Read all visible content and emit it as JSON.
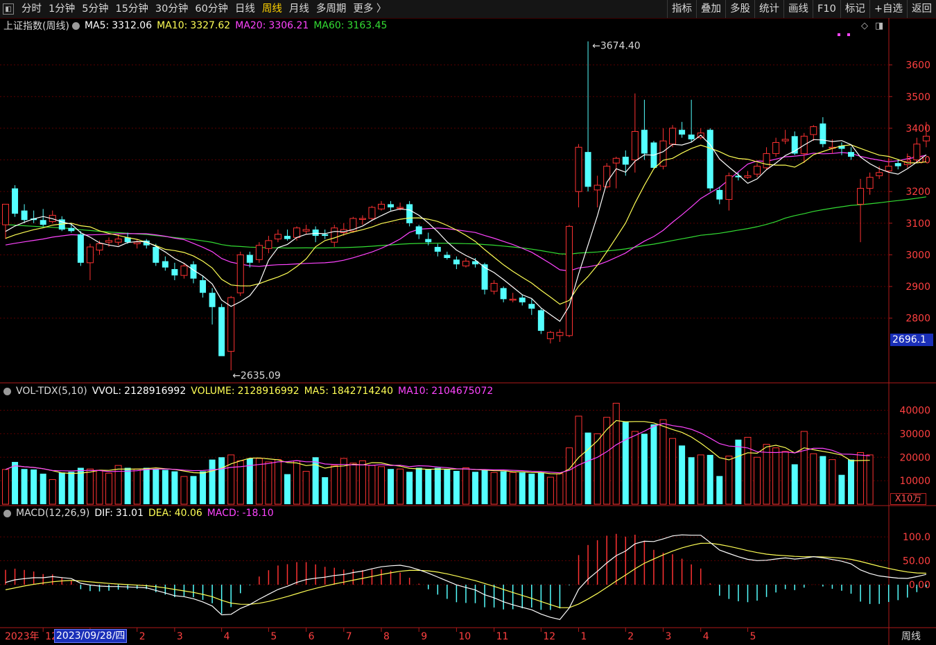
{
  "toolbar": {
    "tabs": [
      "分时",
      "1分钟",
      "5分钟",
      "15分钟",
      "30分钟",
      "60分钟",
      "日线",
      "周线",
      "月线",
      "多周期",
      "更多 〉"
    ],
    "active": "周线",
    "right": [
      "指标",
      "叠加",
      "多股",
      "统计",
      "画线",
      "F10",
      "标记",
      "+自选",
      "返回"
    ]
  },
  "legend": {
    "title": "上证指数(周线)",
    "ma5_label": "MA5:",
    "ma5": "3312.06",
    "ma10_label": "MA10:",
    "ma10": "3327.62",
    "ma20_label": "MA20:",
    "ma20": "3306.21",
    "ma60_label": "MA60:",
    "ma60": "3163.45"
  },
  "vol_legend": {
    "name": "VOL-TDX(5,10)",
    "vvol_label": "VVOL:",
    "vvol": "2128916992",
    "volume_label": "VOLUME:",
    "volume": "2128916992",
    "ma5_label": "MA5:",
    "ma5": "1842714240",
    "ma10_label": "MA10:",
    "ma10": "2104675072"
  },
  "macd_legend": {
    "name": "MACD(12,26,9)",
    "dif_label": "DIF:",
    "dif": "31.01",
    "dea_label": "DEA:",
    "dea": "40.06",
    "macd_label": "MACD:",
    "macd": "-18.10"
  },
  "annotations": {
    "high": "3674.40",
    "low": "2635.09"
  },
  "cursor": {
    "date": "2023/09/28/四",
    "price": "2696.1"
  },
  "bottom": {
    "year": "2023年",
    "period": "周线",
    "unit": "X10万"
  },
  "colors": {
    "up": "#ff3232",
    "down": "#54ffff",
    "ma5": "#ffffff",
    "ma10": "#ffff55",
    "ma20": "#ff44ff",
    "ma60": "#33dd33",
    "grid": "#5a0000",
    "axis": "#b01a1a"
  },
  "chart_data": {
    "type": "candlestick",
    "price_axis": {
      "ticks": [
        2800,
        2900,
        3000,
        3100,
        3200,
        3300,
        3400,
        3500,
        3600
      ],
      "range": [
        2600,
        3700
      ]
    },
    "volume_axis": {
      "ticks": [
        10000,
        20000,
        30000,
        40000
      ],
      "range": [
        0,
        44000
      ]
    },
    "macd_axis": {
      "ticks": [
        "0.00",
        "50.00",
        "100.0"
      ],
      "range": [
        -90,
        135
      ]
    },
    "month_labels": [
      {
        "i": 4,
        "t": "12"
      },
      {
        "i": 9,
        "t": "1"
      },
      {
        "i": 14,
        "t": "2"
      },
      {
        "i": 18,
        "t": "3"
      },
      {
        "i": 23,
        "t": "4"
      },
      {
        "i": 28,
        "t": "5"
      },
      {
        "i": 32,
        "t": "6"
      },
      {
        "i": 36,
        "t": "7"
      },
      {
        "i": 40,
        "t": "8"
      },
      {
        "i": 44,
        "t": "9"
      },
      {
        "i": 48,
        "t": "10"
      },
      {
        "i": 52,
        "t": "11"
      },
      {
        "i": 57,
        "t": "12"
      },
      {
        "i": 61,
        "t": "1"
      },
      {
        "i": 66,
        "t": "2"
      },
      {
        "i": 70,
        "t": "3"
      },
      {
        "i": 74,
        "t": "4"
      },
      {
        "i": 79,
        "t": "5"
      }
    ],
    "candles": [
      [
        3095,
        3160,
        3160,
        3050
      ],
      [
        3210,
        3130,
        3220,
        3120
      ],
      [
        3140,
        3110,
        3160,
        3100
      ],
      [
        3115,
        3110,
        3140,
        3100
      ],
      [
        3110,
        3095,
        3145,
        3090
      ],
      [
        3105,
        3125,
        3140,
        3100
      ],
      [
        3112,
        3080,
        3122,
        3075
      ],
      [
        3085,
        3075,
        3100,
        3070
      ],
      [
        3065,
        2975,
        3075,
        2965
      ],
      [
        2975,
        3025,
        3035,
        2920
      ],
      [
        3015,
        3035,
        3045,
        3000
      ],
      [
        3040,
        3045,
        3055,
        3025
      ],
      [
        3040,
        3050,
        3065,
        3030
      ],
      [
        3055,
        3040,
        3070,
        3035
      ],
      [
        3035,
        3040,
        3050,
        3020
      ],
      [
        3045,
        3030,
        3050,
        3020
      ],
      [
        3025,
        2975,
        3035,
        2965
      ],
      [
        2980,
        2960,
        2995,
        2950
      ],
      [
        2955,
        2935,
        2975,
        2920
      ],
      [
        2935,
        2965,
        2975,
        2925
      ],
      [
        2970,
        2925,
        2980,
        2910
      ],
      [
        2920,
        2880,
        2935,
        2865
      ],
      [
        2880,
        2835,
        2895,
        2780
      ],
      [
        2835,
        2680,
        2845,
        2680
      ],
      [
        2695,
        2865,
        2870,
        2635
      ],
      [
        2880,
        3000,
        3010,
        2870
      ],
      [
        3000,
        2975,
        3010,
        2960
      ],
      [
        2985,
        3030,
        3040,
        2975
      ],
      [
        3020,
        3045,
        3060,
        3005
      ],
      [
        3050,
        3065,
        3080,
        3040
      ],
      [
        3060,
        3050,
        3080,
        3045
      ],
      [
        3055,
        3085,
        3090,
        3045
      ],
      [
        3075,
        3080,
        3095,
        3065
      ],
      [
        3080,
        3060,
        3090,
        3040
      ],
      [
        3065,
        3060,
        3080,
        3050
      ],
      [
        3040,
        3085,
        3095,
        3025
      ],
      [
        3070,
        3080,
        3100,
        3060
      ],
      [
        3075,
        3115,
        3120,
        3070
      ],
      [
        3115,
        3115,
        3125,
        3095
      ],
      [
        3115,
        3150,
        3155,
        3110
      ],
      [
        3145,
        3160,
        3170,
        3140
      ],
      [
        3160,
        3150,
        3170,
        3140
      ],
      [
        3150,
        3150,
        3165,
        3140
      ],
      [
        3160,
        3100,
        3170,
        3090
      ],
      [
        3090,
        3065,
        3095,
        3050
      ],
      [
        3050,
        3040,
        3070,
        3030
      ],
      [
        3025,
        3010,
        3035,
        2995
      ],
      [
        3000,
        2990,
        3010,
        2985
      ],
      [
        2985,
        2970,
        2995,
        2955
      ],
      [
        2965,
        2980,
        2990,
        2960
      ],
      [
        2980,
        2970,
        2990,
        2960
      ],
      [
        2970,
        2890,
        2975,
        2875
      ],
      [
        2885,
        2910,
        2920,
        2875
      ],
      [
        2895,
        2860,
        2900,
        2850
      ],
      [
        2860,
        2860,
        2880,
        2850
      ],
      [
        2865,
        2850,
        2875,
        2840
      ],
      [
        2845,
        2830,
        2860,
        2810
      ],
      [
        2825,
        2760,
        2830,
        2750
      ],
      [
        2735,
        2755,
        2760,
        2720
      ],
      [
        2745,
        2755,
        2765,
        2725
      ],
      [
        2745,
        3090,
        3095,
        2740
      ],
      [
        3200,
        3340,
        3350,
        3150
      ],
      [
        3325,
        3215,
        3674.4,
        3200
      ],
      [
        3205,
        3220,
        3250,
        3150
      ],
      [
        3215,
        3280,
        3290,
        3210
      ],
      [
        3290,
        3305,
        3310,
        3210
      ],
      [
        3310,
        3285,
        3330,
        3250
      ],
      [
        3300,
        3390,
        3510,
        3260
      ],
      [
        3395,
        3320,
        3490,
        3300
      ],
      [
        3355,
        3275,
        3360,
        3270
      ],
      [
        3280,
        3360,
        3400,
        3270
      ],
      [
        3350,
        3400,
        3410,
        3340
      ],
      [
        3395,
        3380,
        3420,
        3370
      ],
      [
        3380,
        3365,
        3490,
        3355
      ],
      [
        3370,
        3385,
        3400,
        3365
      ],
      [
        3395,
        3210,
        3400,
        3200
      ],
      [
        3205,
        3175,
        3215,
        3160
      ],
      [
        3175,
        3250,
        3260,
        3140
      ],
      [
        3250,
        3245,
        3260,
        3235
      ],
      [
        3245,
        3250,
        3265,
        3240
      ],
      [
        3255,
        3280,
        3290,
        3245
      ],
      [
        3275,
        3320,
        3340,
        3270
      ],
      [
        3320,
        3355,
        3370,
        3310
      ],
      [
        3360,
        3365,
        3395,
        3350
      ],
      [
        3375,
        3320,
        3390,
        3315
      ],
      [
        3320,
        3375,
        3385,
        3290
      ],
      [
        3380,
        3405,
        3410,
        3360
      ],
      [
        3415,
        3350,
        3435,
        3340
      ],
      [
        3340,
        3340,
        3365,
        3320
      ],
      [
        3345,
        3335,
        3355,
        3315
      ],
      [
        3325,
        3310,
        3340,
        3300
      ],
      [
        3160,
        3210,
        3240,
        3040
      ],
      [
        3210,
        3245,
        3260,
        3190
      ],
      [
        3250,
        3260,
        3280,
        3240
      ],
      [
        3265,
        3280,
        3305,
        3260
      ],
      [
        3290,
        3280,
        3300,
        3270
      ],
      [
        3285,
        3295,
        3320,
        3275
      ],
      [
        3300,
        3350,
        3370,
        3290
      ],
      [
        3360,
        3375,
        3420,
        3340
      ]
    ],
    "volumes": [
      14800,
      18000,
      15000,
      14800,
      13000,
      10500,
      13500,
      13800,
      15500,
      15000,
      14500,
      13200,
      16500,
      15500,
      15000,
      15500,
      14800,
      14600,
      14000,
      11800,
      12000,
      14000,
      19000,
      20000,
      21000,
      18500,
      19500,
      19500,
      18000,
      19000,
      12800,
      18500,
      14000,
      20000,
      11500,
      16500,
      19500,
      17500,
      18500,
      16500,
      16000,
      15000,
      15000,
      13800,
      15500,
      15000,
      15500,
      14800,
      14200,
      15500,
      13800,
      14500,
      13500,
      14000,
      13500,
      13500,
      13000,
      13500,
      11500,
      13000,
      24000,
      37500,
      30500,
      30000,
      37000,
      43000,
      35000,
      31000,
      30000,
      34000,
      36000,
      28000,
      25000,
      20000,
      21000,
      21000,
      12000,
      20500,
      27500,
      28500,
      20000,
      25500,
      24000,
      22500,
      17000,
      31000,
      21500,
      20500,
      19000,
      12500,
      19000,
      22000,
      21000
    ]
  }
}
